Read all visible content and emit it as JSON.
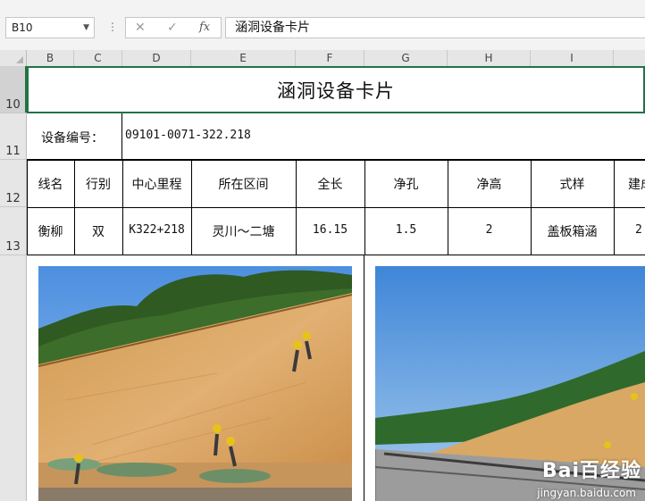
{
  "formula_bar": {
    "name_box": "B10",
    "formula": "涵洞设备卡片",
    "fx_label": "fx",
    "cancel_glyph": "✕",
    "enter_glyph": "✓"
  },
  "columns": [
    "B",
    "C",
    "D",
    "E",
    "F",
    "G",
    "H",
    "I"
  ],
  "rows": [
    "10",
    "11",
    "12",
    "13"
  ],
  "card": {
    "title": "涵洞设备卡片",
    "device_no_label": "设备编号：",
    "device_no_value": "09101-0071-322.218",
    "headers": [
      "线名",
      "行别",
      "中心里程",
      "所在区间",
      "全长",
      "净孔",
      "净高",
      "式样",
      "建成"
    ],
    "values": [
      "衡柳",
      "双",
      "K322+218",
      "灵川～二塘",
      "16.15",
      "1.5",
      "2",
      "盖板箱涵",
      "2"
    ]
  },
  "watermark": {
    "main": "Bai百经验",
    "sub": "jingyan.baidu.com"
  },
  "colors": {
    "accent": "#217346",
    "header_bg": "#e6e6e6"
  }
}
